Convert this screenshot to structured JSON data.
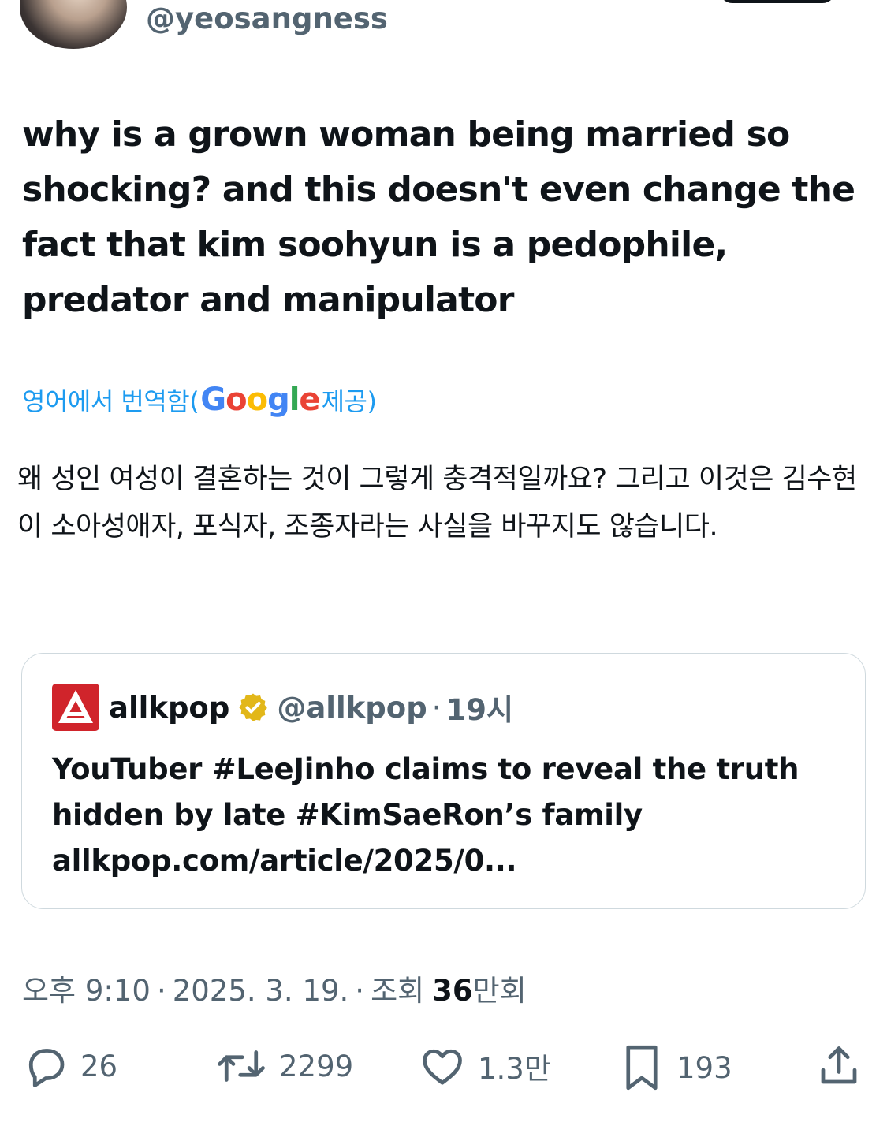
{
  "author": {
    "handle": "@yeosangness"
  },
  "tweet": {
    "text": "why is a grown woman being married so shocking? and this doesn't even change the fact that kim soohyun is a pedophile, predator and manipulator",
    "translation_prefix": "영어에서 번역함(",
    "translation_provider": "Google",
    "translation_suffix": " 제공)",
    "translated_text": "왜 성인 여성이 결혼하는 것이 그렇게 충격적일까요? 그리고 이것은 김수현이 소아성애자, 포식자, 조종자라는 사실을 바꾸지도 않습니다."
  },
  "quote": {
    "name": "allkpop",
    "handle": "@allkpop",
    "dot": "·",
    "time": "19시",
    "text": "YouTuber #LeeJinho claims to reveal the truth hidden by late #KimSaeRon’s family allkpop.com/article/2025/0..."
  },
  "meta": {
    "time": "오후 9:10",
    "dot": "·",
    "date": "2025. 3. 19.",
    "views_prefix": "조회",
    "views_number": "36",
    "views_unit": "만회"
  },
  "actions": {
    "replies": "26",
    "retweets": "2299",
    "likes": "1.3만",
    "bookmarks": "193"
  },
  "icons": {
    "reply": "reply-icon",
    "retweet": "retweet-icon",
    "like": "heart-icon",
    "bookmark": "bookmark-icon",
    "share": "share-icon",
    "verified": "verified-badge-icon"
  },
  "colors": {
    "link_blue": "#1d9bf0",
    "muted": "#536471",
    "text": "#0f1419",
    "verified_gold": "#e2b719",
    "allkpop_red": "#d0242b"
  }
}
